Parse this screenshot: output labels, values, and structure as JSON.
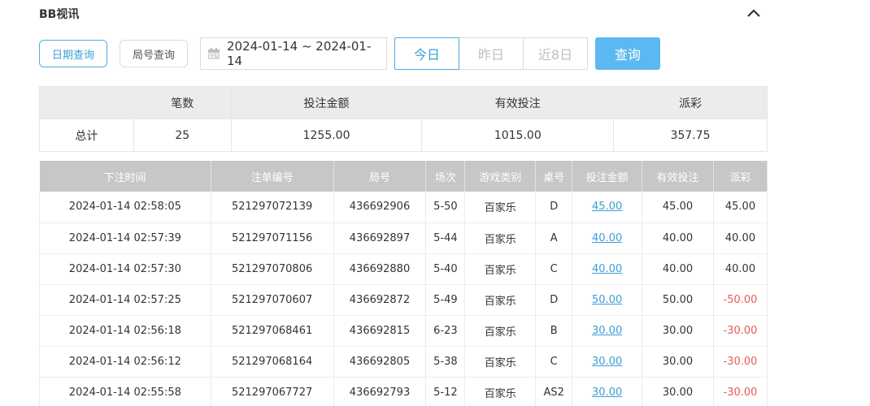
{
  "header": {
    "title": "BB视讯"
  },
  "filters": {
    "mode_date_label": "日期查询",
    "mode_round_label": "局号查询",
    "date_range": "2024-01-14 ~ 2024-01-14",
    "quick_today": "今日",
    "quick_yesterday": "昨日",
    "quick_last8": "近8日",
    "query_label": "查询"
  },
  "summary": {
    "headers": [
      "",
      "笔数",
      "投注金额",
      "有效投注",
      "派彩"
    ],
    "row": [
      "总计",
      "25",
      "1255.00",
      "1015.00",
      "357.75"
    ]
  },
  "records": {
    "headers": [
      "下注时间",
      "注单编号",
      "局号",
      "场次",
      "游戏类别",
      "桌号",
      "投注金额",
      "有效投注",
      "派彩"
    ],
    "rows": [
      [
        "2024-01-14 02:58:05",
        "521297072139",
        "436692906",
        "5-50",
        "百家乐",
        "D",
        "45.00",
        "45.00",
        "45.00"
      ],
      [
        "2024-01-14 02:57:39",
        "521297071156",
        "436692897",
        "5-44",
        "百家乐",
        "A",
        "40.00",
        "40.00",
        "40.00"
      ],
      [
        "2024-01-14 02:57:30",
        "521297070806",
        "436692880",
        "5-40",
        "百家乐",
        "C",
        "40.00",
        "40.00",
        "40.00"
      ],
      [
        "2024-01-14 02:57:25",
        "521297070607",
        "436692872",
        "5-49",
        "百家乐",
        "D",
        "50.00",
        "50.00",
        "-50.00"
      ],
      [
        "2024-01-14 02:56:18",
        "521297068461",
        "436692815",
        "6-23",
        "百家乐",
        "B",
        "30.00",
        "30.00",
        "-30.00"
      ],
      [
        "2024-01-14 02:56:12",
        "521297068164",
        "436692805",
        "5-38",
        "百家乐",
        "C",
        "30.00",
        "30.00",
        "-30.00"
      ],
      [
        "2024-01-14 02:55:58",
        "521297067727",
        "436692793",
        "5-12",
        "百家乐",
        "AS2",
        "30.00",
        "30.00",
        "-30.00"
      ]
    ]
  },
  "colors": {
    "accent": "#3a9fd6",
    "negative": "#e85a5a",
    "query_button": "#5cb8f0"
  },
  "icons": {
    "collapse": "chevron-up-icon",
    "calendar": "calendar-icon"
  }
}
